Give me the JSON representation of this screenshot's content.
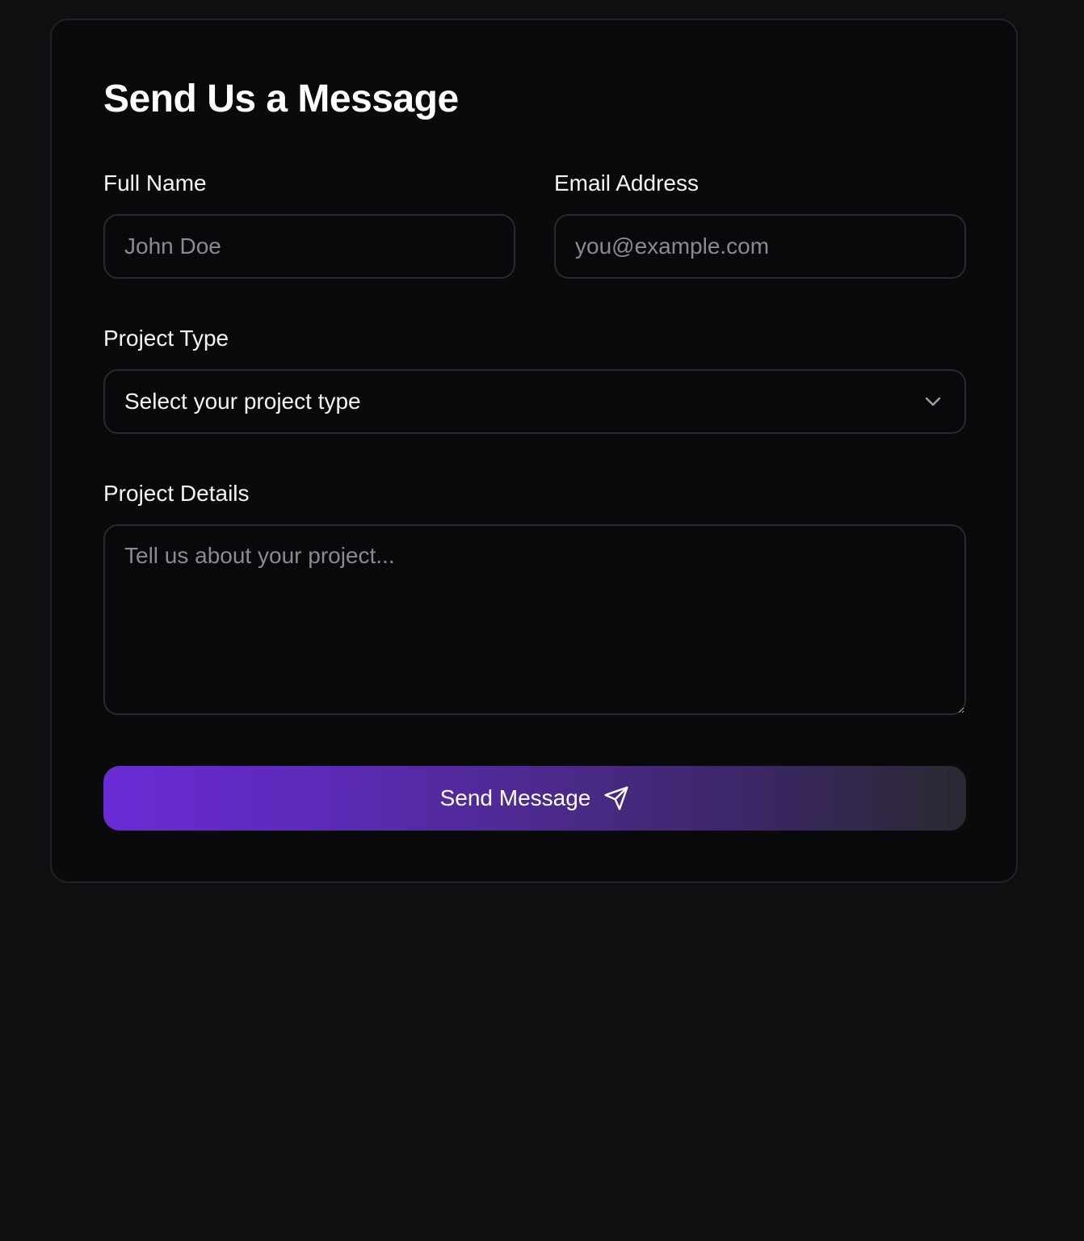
{
  "form": {
    "title": "Send Us a Message",
    "full_name": {
      "label": "Full Name",
      "value": "",
      "placeholder": "John Doe"
    },
    "email": {
      "label": "Email Address",
      "value": "",
      "placeholder": "you@example.com"
    },
    "project_type": {
      "label": "Project Type",
      "selected": "Select your project type",
      "icon": "chevron-down-icon"
    },
    "project_details": {
      "label": "Project Details",
      "value": "",
      "placeholder": "Tell us about your project..."
    },
    "submit": {
      "label": "Send Message",
      "icon": "send-icon"
    }
  },
  "colors": {
    "page_background": "#0f0f11",
    "card_background": "#0a0a0c",
    "border": "#2a2a2e",
    "button_gradient_start": "#6a2bd6",
    "button_gradient_end": "#2a2830"
  }
}
